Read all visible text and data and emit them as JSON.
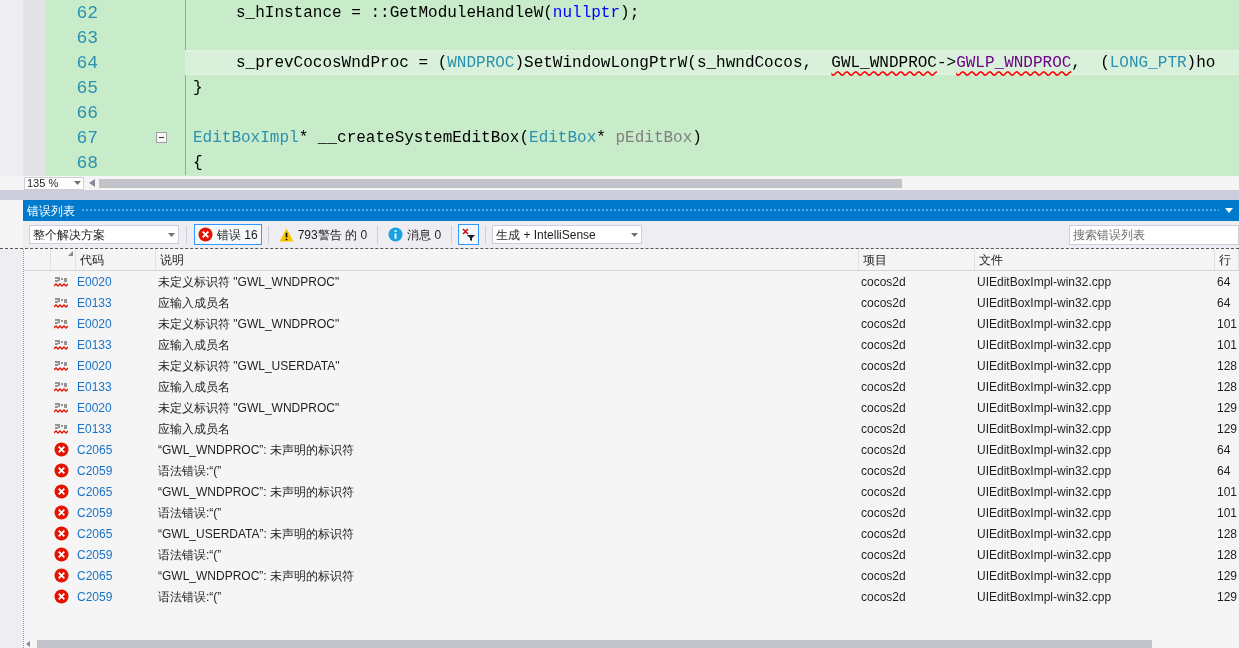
{
  "editor": {
    "zoom": "135 %",
    "lines": [
      {
        "number": "62",
        "indented": true,
        "current": false,
        "tokens": [
          {
            "kind": "plain",
            "text": "s_hInstance = ::GetModuleHandleW("
          },
          {
            "kind": "keyword",
            "text": "nullptr"
          },
          {
            "kind": "plain",
            "text": ");"
          }
        ]
      },
      {
        "number": "63",
        "current": false
      },
      {
        "number": "64",
        "indented": true,
        "current": true,
        "tokens": [
          {
            "kind": "plain",
            "text": "s_prevCocosWndProc = ("
          },
          {
            "kind": "type",
            "text": "WNDPROC"
          },
          {
            "kind": "plain",
            "text": ")SetWindowLongPtrW(s_hwndCocos,  "
          },
          {
            "kind": "plain",
            "text": "GWL_WNDPROC",
            "error": true
          },
          {
            "kind": "plain",
            "text": "->"
          },
          {
            "kind": "macro",
            "text": "GWLP_WNDPROC",
            "error": true
          },
          {
            "kind": "plain",
            "text": ",  ("
          },
          {
            "kind": "type",
            "text": "LONG_PTR"
          },
          {
            "kind": "plain",
            "text": ")ho"
          }
        ]
      },
      {
        "number": "65",
        "indented": false,
        "current": false,
        "tokens": [
          {
            "kind": "plain",
            "text": "}"
          }
        ]
      },
      {
        "number": "66",
        "current": false
      },
      {
        "number": "67",
        "indented": false,
        "current": false,
        "foldable": true,
        "tokens": [
          {
            "kind": "type",
            "text": "EditBoxImpl"
          },
          {
            "kind": "plain",
            "text": "* __createSystemEditBox("
          },
          {
            "kind": "type",
            "text": "EditBox"
          },
          {
            "kind": "plain",
            "text": "* "
          },
          {
            "kind": "param",
            "text": "pEditBox"
          },
          {
            "kind": "plain",
            "text": ")"
          }
        ]
      },
      {
        "number": "68",
        "indented": false,
        "current": false,
        "tokens": [
          {
            "kind": "plain",
            "text": "{"
          }
        ]
      }
    ]
  },
  "error_list": {
    "title": "错误列表",
    "scope": "整个解决方案",
    "filters": [
      {
        "kind": "error",
        "label": "错误 16",
        "selected": true
      },
      {
        "kind": "warning",
        "label": "793警告 的 0",
        "selected": false
      },
      {
        "kind": "info",
        "label": "消息 0",
        "selected": false
      }
    ],
    "filter_toggle": {
      "on": true
    },
    "source": "生成 + IntelliSense",
    "search": {
      "placeholder": "搜索错误列表"
    },
    "columns": [
      "代码",
      "说明",
      "项目",
      "文件",
      "行"
    ],
    "rows": [
      {
        "kind": "intellisense",
        "code": "E0020",
        "description": "未定义标识符 \"GWL_WNDPROC\"",
        "project": "cocos2d",
        "file": "UIEditBoxImpl-win32.cpp",
        "line": "64"
      },
      {
        "kind": "intellisense",
        "code": "E0133",
        "description": "应输入成员名",
        "project": "cocos2d",
        "file": "UIEditBoxImpl-win32.cpp",
        "line": "64"
      },
      {
        "kind": "intellisense",
        "code": "E0020",
        "description": "未定义标识符 \"GWL_WNDPROC\"",
        "project": "cocos2d",
        "file": "UIEditBoxImpl-win32.cpp",
        "line": "101"
      },
      {
        "kind": "intellisense",
        "code": "E0133",
        "description": "应输入成员名",
        "project": "cocos2d",
        "file": "UIEditBoxImpl-win32.cpp",
        "line": "101"
      },
      {
        "kind": "intellisense",
        "code": "E0020",
        "description": "未定义标识符 \"GWL_USERDATA\"",
        "project": "cocos2d",
        "file": "UIEditBoxImpl-win32.cpp",
        "line": "128"
      },
      {
        "kind": "intellisense",
        "code": "E0133",
        "description": "应输入成员名",
        "project": "cocos2d",
        "file": "UIEditBoxImpl-win32.cpp",
        "line": "128"
      },
      {
        "kind": "intellisense",
        "code": "E0020",
        "description": "未定义标识符 \"GWL_WNDPROC\"",
        "project": "cocos2d",
        "file": "UIEditBoxImpl-win32.cpp",
        "line": "129"
      },
      {
        "kind": "intellisense",
        "code": "E0133",
        "description": "应输入成员名",
        "project": "cocos2d",
        "file": "UIEditBoxImpl-win32.cpp",
        "line": "129"
      },
      {
        "kind": "build",
        "code": "C2065",
        "description": "“GWL_WNDPROC”: 未声明的标识符",
        "project": "cocos2d",
        "file": "UIEditBoxImpl-win32.cpp",
        "line": "64"
      },
      {
        "kind": "build",
        "code": "C2059",
        "description": "语法错误:“(”",
        "project": "cocos2d",
        "file": "UIEditBoxImpl-win32.cpp",
        "line": "64"
      },
      {
        "kind": "build",
        "code": "C2065",
        "description": "“GWL_WNDPROC”: 未声明的标识符",
        "project": "cocos2d",
        "file": "UIEditBoxImpl-win32.cpp",
        "line": "101"
      },
      {
        "kind": "build",
        "code": "C2059",
        "description": "语法错误:“(”",
        "project": "cocos2d",
        "file": "UIEditBoxImpl-win32.cpp",
        "line": "101"
      },
      {
        "kind": "build",
        "code": "C2065",
        "description": "“GWL_USERDATA”: 未声明的标识符",
        "project": "cocos2d",
        "file": "UIEditBoxImpl-win32.cpp",
        "line": "128"
      },
      {
        "kind": "build",
        "code": "C2059",
        "description": "语法错误:“(”",
        "project": "cocos2d",
        "file": "UIEditBoxImpl-win32.cpp",
        "line": "128"
      },
      {
        "kind": "build",
        "code": "C2065",
        "description": "“GWL_WNDPROC”: 未声明的标识符",
        "project": "cocos2d",
        "file": "UIEditBoxImpl-win32.cpp",
        "line": "129"
      },
      {
        "kind": "build",
        "code": "C2059",
        "description": "语法错误:“(”",
        "project": "cocos2d",
        "file": "UIEditBoxImpl-win32.cpp",
        "line": "129"
      }
    ]
  }
}
